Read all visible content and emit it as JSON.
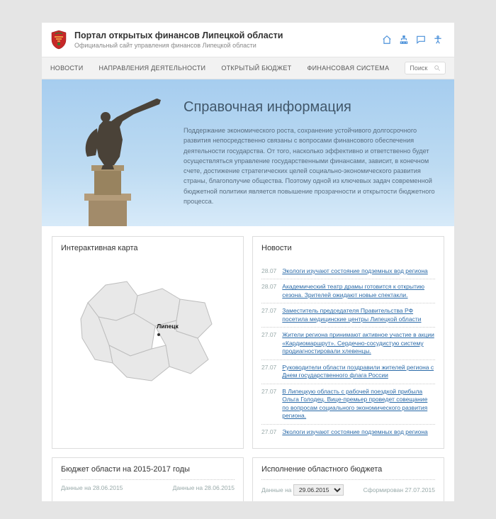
{
  "header": {
    "site_title": "Портал открытых финансов Липецкой области",
    "site_subtitle": "Официальный сайт управления финансов Липецкой области"
  },
  "nav": {
    "items": [
      "НОВОСТИ",
      "НАПРАВЛЕНИЯ ДЕЯТЕЛЬНОСТИ",
      "ОТКРЫТЫЙ БЮДЖЕТ",
      "ФИНАНСОВАЯ СИСТЕМА"
    ],
    "search_placeholder": "Поиск"
  },
  "hero": {
    "title": "Справочная информация",
    "body": "Поддержание экономического роста, сохранение устойчивого долгосрочного развития непосредственно связаны с вопросами финансового обеспечения деятельности государства. От того, насколько эффективно и ответственно будет осуществляться управление государственными финансами, зависит, в конечном счете, достижение стратегических целей социально-экономического развития страны, благополучие общества. Поэтому одной из ключевых задач современной бюджетной политики является повышение прозрачности и открытости бюджетного процесса."
  },
  "cards": {
    "map_title": "Интерактивная карта",
    "map_label": "Липецк",
    "news_title": "Новости"
  },
  "news": [
    {
      "date": "28.07",
      "title": "Экологи изучают состояние подземных вод региона"
    },
    {
      "date": "28.07",
      "title": "Академический театр драмы готовится к открытию сезона. Зрителей ожидают новые спектакли."
    },
    {
      "date": "27.07",
      "title": "Заместитель председателя Правительства РФ посетила медицинские центры Липецкой области"
    },
    {
      "date": "27.07",
      "title": "Жители региона принимают активное участие в акции «Кардиомаршрут». Сердечно-сосудистую систему продиагностировали хлевенцы."
    },
    {
      "date": "27.07",
      "title": "Руководители области поздравили жителей региона с Днем государственного флага России"
    },
    {
      "date": "27.07",
      "title": "В Липецкую область с рабочей поездкой прибыла Ольга Голодец. Вице-премьер проведет совещание по вопросам социального экономического развития региона."
    },
    {
      "date": "27.07",
      "title": "Экологи изучают состояние подземных вод региона"
    }
  ],
  "bottom": {
    "budget_title": "Бюджет области на 2015-2017 годы",
    "budget_meta_left": "Данные на 28.06.2015",
    "budget_meta_right": "Данные на 28.06.2015",
    "exec_title": "Исполнение областного бюджета",
    "exec_label": "Данные на",
    "exec_select": "29.06.2015",
    "exec_formed": "Сформирован 27.07.2015"
  }
}
